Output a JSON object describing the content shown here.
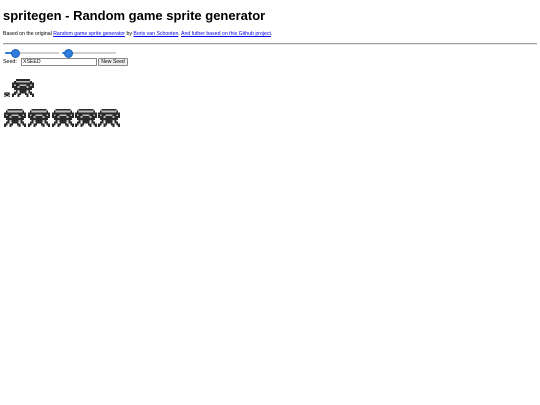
{
  "header": {
    "title": "spritegen - Random game sprite generator",
    "credit_prefix": "Based on the original ",
    "credit_link1": "Random game sprite generator",
    "credit_by": " by ",
    "credit_link2": "Boris van Schooten",
    "credit_sep": ". ",
    "credit_link3": "And futher based on this Github project",
    "credit_suffix": "."
  },
  "controls": {
    "slider1_value_pct": 18,
    "slider2_value_pct": 10,
    "seed_label": "Seed:",
    "seed_value": "XSEED",
    "new_seed_label": "New Seed"
  },
  "colors": {
    "accent": "#2f7de1",
    "sprite_dark": "#2a2a2a",
    "sprite_light": "#bdbdbd"
  },
  "sprites": {
    "small_count": 1,
    "medium_count": 1,
    "large_count": 5
  }
}
